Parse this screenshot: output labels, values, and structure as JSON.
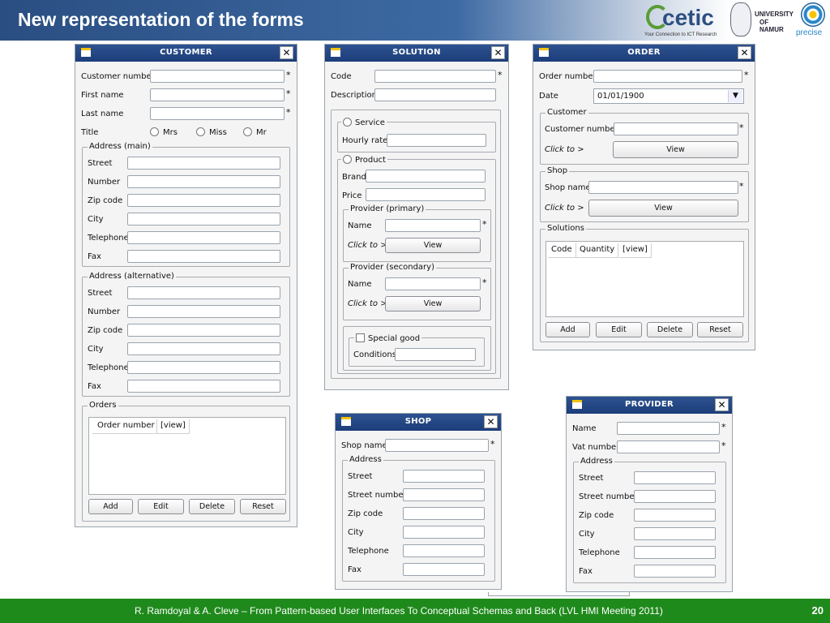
{
  "slide": {
    "title": "New representation of the forms",
    "footer": "R. Ramdoyal & A. Cleve – From Pattern-based User Interfaces To Conceptual Schemas and Back (LVL HMI Meeting 2011)",
    "page_number": "20",
    "logos": {
      "cetic": "cetic",
      "cetic_tagline": "Your Connection to ICT Research",
      "unamur_line1": "UNIVERSITY",
      "unamur_line2": "OF NAMUR",
      "precise": "precise"
    }
  },
  "customer": {
    "title": "CUSTOMER",
    "customer_number": "Customer number",
    "first_name": "First name",
    "last_name": "Last name",
    "title_label": "Title",
    "mrs": "Mrs",
    "miss": "Miss",
    "mr": "Mr",
    "address_main": "Address (main)",
    "address_alt": "Address (alternative)",
    "street": "Street",
    "number": "Number",
    "zip": "Zip code",
    "city": "City",
    "telephone": "Telephone",
    "fax": "Fax",
    "orders": "Orders",
    "col_order_number": "Order number",
    "col_view": "[view]",
    "add": "Add",
    "edit": "Edit",
    "delete": "Delete",
    "reset": "Reset"
  },
  "solution": {
    "title": "SOLUTION",
    "code": "Code",
    "description": "Description",
    "service": "Service",
    "hourly_rate": "Hourly rate",
    "product": "Product",
    "brand": "Brand",
    "price": "Price",
    "provider_primary": "Provider (primary)",
    "provider_secondary": "Provider (secondary)",
    "name": "Name",
    "click_to": "Click to >",
    "view": "View",
    "special_good": "Special good",
    "conditions": "Conditions"
  },
  "order": {
    "title": "ORDER",
    "order_number": "Order number",
    "date": "Date",
    "date_value": "01/01/1900",
    "customer": "Customer",
    "customer_number": "Customer number",
    "shop": "Shop",
    "shop_name": "Shop name",
    "click_to": "Click to >",
    "view": "View",
    "solutions": "Solutions",
    "col_code": "Code",
    "col_quantity": "Quantity",
    "col_view": "[view]",
    "add": "Add",
    "edit": "Edit",
    "delete": "Delete",
    "reset": "Reset"
  },
  "shop": {
    "title": "SHOP",
    "shop_name": "Shop name",
    "address": "Address",
    "street": "Street",
    "street_number": "Street number",
    "zip": "Zip code",
    "city": "City",
    "telephone": "Telephone",
    "fax": "Fax"
  },
  "provider": {
    "title": "PROVIDER",
    "name": "Name",
    "vat_number": "Vat number",
    "address": "Address",
    "street": "Street",
    "street_number": "Street number",
    "zip": "Zip code",
    "city": "City",
    "telephone": "Telephone",
    "fax": "Fax"
  },
  "required_mark": "*"
}
